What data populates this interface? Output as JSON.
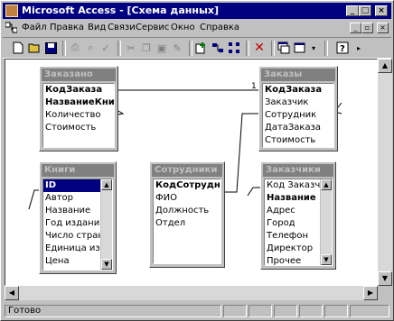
{
  "window": {
    "title": "Microsoft Access - [Схема данных]"
  },
  "menu": [
    "Файл",
    "Правка",
    "Вид",
    "Связи",
    "Сервис",
    "Окно",
    "Справка"
  ],
  "toolbar": {
    "icons": [
      "new-icon",
      "open-icon",
      "save-icon",
      "print-icon",
      "print-preview-icon",
      "spell-icon",
      "cut-icon",
      "copy-icon",
      "paste-icon",
      "format-painter-icon",
      "show-table-icon",
      "show-direct-icon",
      "show-all-icon",
      "delete-icon",
      "database-window-icon",
      "new-object-icon",
      "help-icon"
    ]
  },
  "tables": [
    {
      "name": "Заказано",
      "fields": [
        "КодЗаказа",
        "НазваниеКниги",
        "Количество",
        "Стоимость"
      ],
      "pk": [
        0,
        1
      ]
    },
    {
      "name": "Заказы",
      "fields": [
        "КодЗаказа",
        "Заказчик",
        "Сотрудник",
        "ДатаЗаказа",
        "Стоимость"
      ],
      "pk": [
        0
      ]
    },
    {
      "name": "Книги",
      "fields": [
        "ID",
        "Автор",
        "Название",
        "Год издания",
        "Число страниц",
        "Единица измерения",
        "Цена"
      ],
      "pk": [
        0
      ],
      "selected": 0
    },
    {
      "name": "Сотрудники",
      "fields": [
        "КодСотрудника",
        "ФИО",
        "Должность",
        "Отдел"
      ],
      "pk": [
        0
      ]
    },
    {
      "name": "Заказчики",
      "fields": [
        "Код Заказчика",
        "Название",
        "Адрес",
        "Город",
        "Телефон",
        "Директор",
        "Прочее"
      ],
      "pk": [],
      "bold": [
        1
      ]
    }
  ],
  "relations": {
    "one_symbol": "1",
    "many_symbol": "∞"
  },
  "status": {
    "text": "Готово"
  }
}
